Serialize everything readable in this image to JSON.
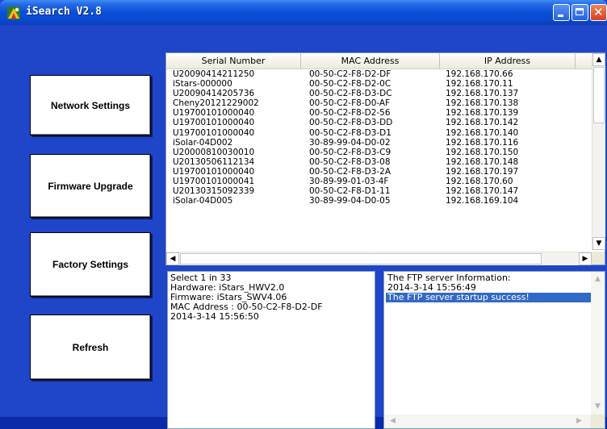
{
  "window": {
    "title": "iSearch V2.8",
    "close_glyph": "✕",
    "colors": {
      "titlebar": "#0a4fd7",
      "client": "#1f45c9",
      "selection": "#3169c6"
    }
  },
  "sidebar": {
    "buttons": [
      {
        "label": "Network Settings"
      },
      {
        "label": "Firmware Upgrade"
      },
      {
        "label": "Factory Settings"
      },
      {
        "label": "Refresh"
      }
    ]
  },
  "device_list": {
    "columns": [
      "Serial Number",
      "MAC Address",
      "IP Address"
    ],
    "rows": [
      {
        "serial": "U20090414211250",
        "mac": "00-50-C2-F8-D2-DF",
        "ip": "192.168.170.66"
      },
      {
        "serial": "iStars-000000",
        "mac": "00-50-C2-F8-D2-0C",
        "ip": "192.168.170.11"
      },
      {
        "serial": "U20090414205736",
        "mac": "00-50-C2-F8-D3-DC",
        "ip": "192.168.170.137"
      },
      {
        "serial": "Cheny20121229002",
        "mac": "00-50-C2-F8-D0-AF",
        "ip": "192.168.170.138"
      },
      {
        "serial": "U19700101000040",
        "mac": "00-50-C2-F8-D2-56",
        "ip": "192.168.170.139"
      },
      {
        "serial": "U19700101000040",
        "mac": "00-50-C2-F8-D3-DD",
        "ip": "192.168.170.142"
      },
      {
        "serial": "U19700101000040",
        "mac": "00-50-C2-F8-D3-D1",
        "ip": "192.168.170.140"
      },
      {
        "serial": "iSolar-04D002",
        "mac": "30-89-99-04-D0-02",
        "ip": "192.168.170.116"
      },
      {
        "serial": "U20000810030010",
        "mac": "00-50-C2-F8-D3-C9",
        "ip": "192.168.170.150"
      },
      {
        "serial": "U20130506112134",
        "mac": "00-50-C2-F8-D3-08",
        "ip": "192.168.170.148"
      },
      {
        "serial": "U19700101000040",
        "mac": "00-50-C2-F8-D3-2A",
        "ip": "192.168.170.197"
      },
      {
        "serial": "U19700101000041",
        "mac": "30-89-99-01-03-4F",
        "ip": "192.168.170.60"
      },
      {
        "serial": "U20130315092339",
        "mac": "00-50-C2-F8-D1-11",
        "ip": "192.168.170.147"
      },
      {
        "serial": "iSolar-04D005",
        "mac": "30-89-99-04-D0-05",
        "ip": "192.168.169.104"
      }
    ]
  },
  "device_info": {
    "lines": [
      "Select 1 in 33",
      "Hardware: iStars_HWV2.0",
      "Firmware: iStars_SWV4.06",
      "MAC Address : 00-50-C2-F8-D2-DF",
      "2014-3-14 15:56:50"
    ]
  },
  "ftp_log": {
    "lines": [
      "The FTP server Information:",
      "2014-3-14 15:56:49",
      "The FTP server startup success!"
    ],
    "selected_index": 2
  },
  "scroll_glyphs": {
    "up": "▲",
    "down": "▼",
    "left": "◀",
    "right": "▶"
  }
}
